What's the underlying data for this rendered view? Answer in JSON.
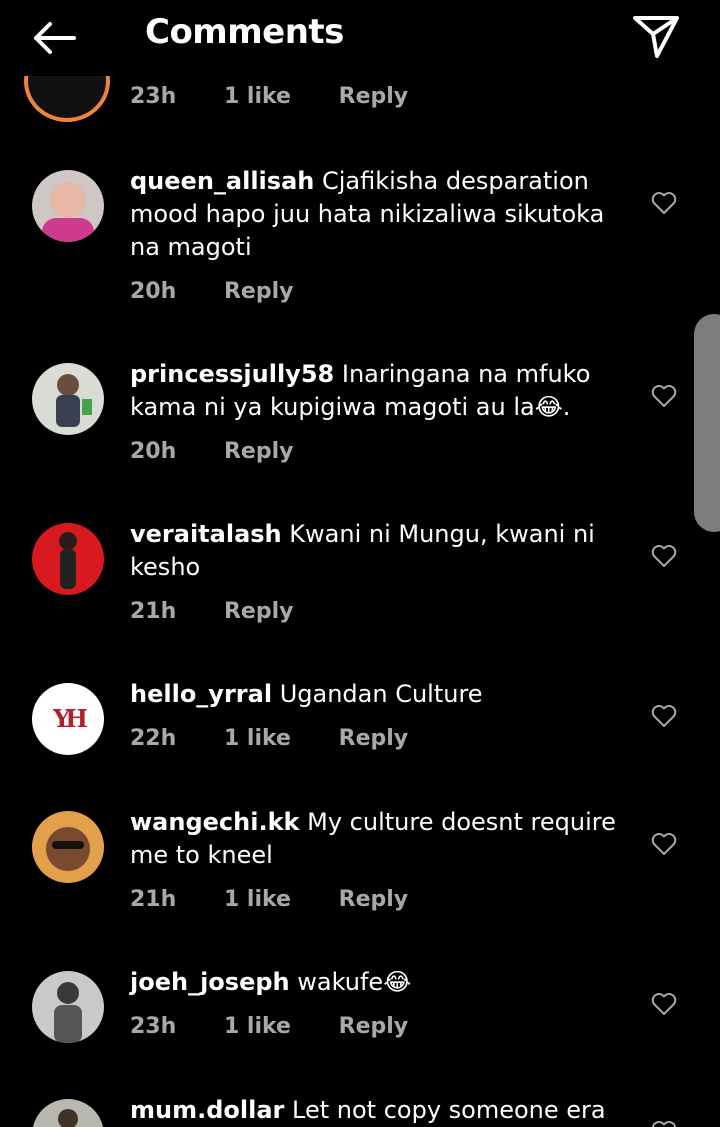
{
  "header": {
    "title": "Comments"
  },
  "partial_top": {
    "time": "23h",
    "likes": "1 like",
    "reply": "Reply"
  },
  "comments": [
    {
      "user": "queen_allisah",
      "text": "Cjafikisha desparation mood hapo juu hata nikizaliwa sikutoka na magoti",
      "time": "20h",
      "likes": "",
      "reply": "Reply"
    },
    {
      "user": "princessjully58",
      "text": "Inaringana na mfuko kama ni ya kupigiwa magoti au la😂.",
      "time": "20h",
      "likes": "",
      "reply": "Reply"
    },
    {
      "user": "veraitalash",
      "text": "Kwani ni Mungu, kwani ni kesho",
      "time": "21h",
      "likes": "",
      "reply": "Reply"
    },
    {
      "user": "hello_yrral",
      "text": "Ugandan Culture",
      "time": "22h",
      "likes": "1 like",
      "reply": "Reply"
    },
    {
      "user": "wangechi.kk",
      "text": "My culture doesnt require me to kneel",
      "time": "21h",
      "likes": "1 like",
      "reply": "Reply"
    },
    {
      "user": "joeh_joseph",
      "text": "wakufe😂",
      "time": "23h",
      "likes": "1 like",
      "reply": "Reply"
    },
    {
      "user": "mum.dollar",
      "text": "Let not  copy someone  era",
      "time": "",
      "likes": "",
      "reply": ""
    }
  ],
  "avatar_logo_text": "YH",
  "colors": {
    "background": "#000000",
    "meta": "#a8a8a8",
    "scroll_handle": "#7d7d7d",
    "story_ring": "#f0843a"
  }
}
